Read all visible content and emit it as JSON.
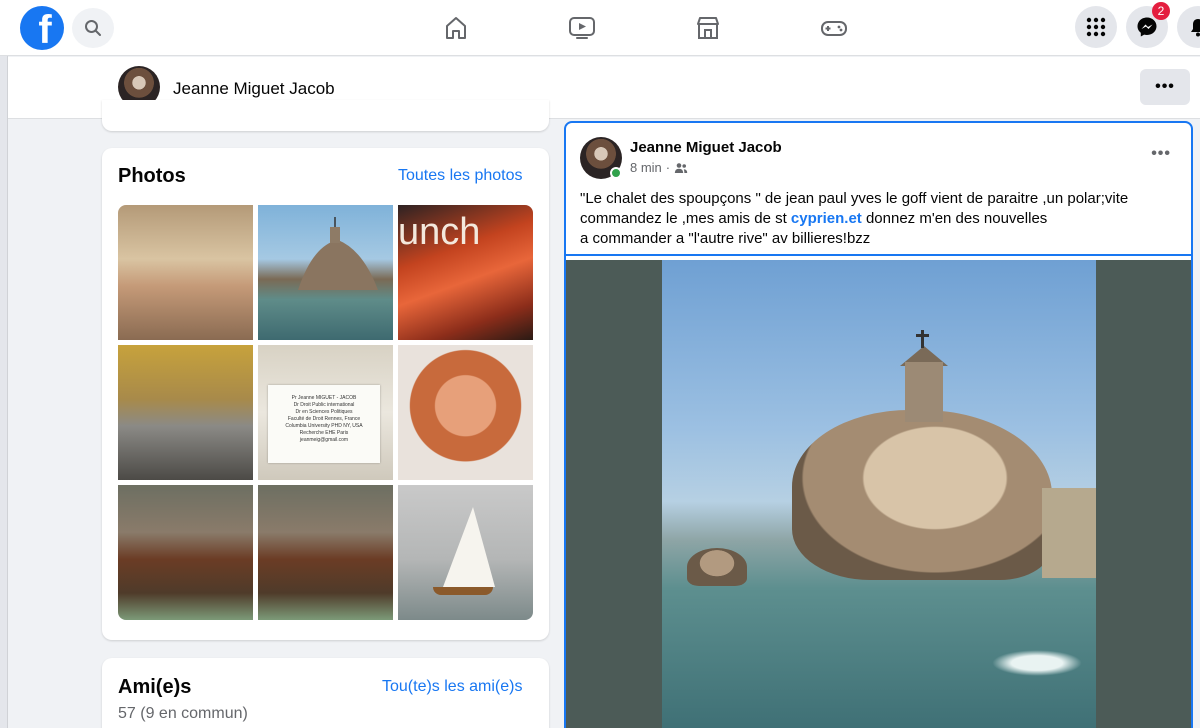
{
  "colors": {
    "brand": "#1877f2",
    "badge": "#e41e3f",
    "online": "#31a24c",
    "page_bg": "#f0f2f5"
  },
  "topbar": {
    "logo": "f",
    "icons": [
      "facebook-logo-icon",
      "search-icon",
      "home-icon",
      "video-icon",
      "marketplace-icon",
      "gaming-icon",
      "menu-grid-icon",
      "messenger-icon",
      "notifications-icon"
    ],
    "messenger_badge": "2"
  },
  "profile_header": {
    "name": "Jeanne Miguet Jacob",
    "more": "•••"
  },
  "photos": {
    "title": "Photos",
    "link": "Toutes les photos",
    "note_lines": [
      "Pr Jeanne MIGUET - JACOB",
      "Dr Droit Public international",
      "Dr en Sciences Politiques",
      "Faculté de Droit Rennes, France",
      "Columbia University PHD NY, USA",
      "Recherche EHE Paris",
      "jeanmeig@gmail.com"
    ],
    "poster_text": "unch"
  },
  "friends": {
    "title": "Ami(e)s",
    "link": "Tou(te)s les ami(e)s",
    "count": "57 (9 en commun)"
  },
  "post": {
    "author": "Jeanne Miguet Jacob",
    "time": "8 min",
    "separator": "·",
    "more": "•••",
    "text_line1": "\"Le  chalet des spoupçons \" de jean paul yves le goff  vient de paraitre ,un polar;vite",
    "text_line2_a": "commandez le ,mes amis de st ",
    "text_line2_link": "cyprien.et",
    "text_line2_b": " donnez m'en des nouvelles",
    "text_line3": "a commander a \"l'autre rive\" av billieres!bzz"
  }
}
